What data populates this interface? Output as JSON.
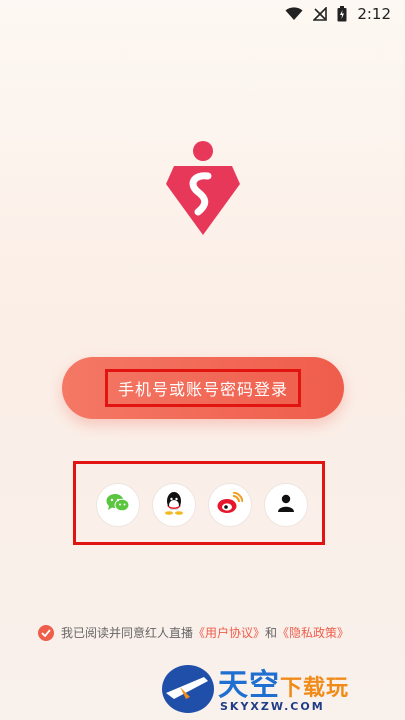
{
  "status_bar": {
    "time": "2:12"
  },
  "login": {
    "button_label": "手机号或账号密码登录"
  },
  "social_logins": [
    {
      "name": "wechat-icon",
      "color": "#5ac640"
    },
    {
      "name": "qq-icon",
      "color": "#111111"
    },
    {
      "name": "weibo-icon",
      "color": "#e6162d"
    },
    {
      "name": "user-icon",
      "color": "#111111"
    }
  ],
  "agreement": {
    "prefix": "我已阅读并同意红人直播",
    "user_agreement": "《用户协议》",
    "and": "和",
    "privacy_policy": "《隐私政策》"
  },
  "watermark": {
    "title_blue": "天空",
    "title_orange": "下载玩",
    "domain": "SKYXZW.COM"
  },
  "colors": {
    "accent": "#ef5d4b",
    "highlight_box": "#e21412",
    "logo": "#e8385a"
  }
}
